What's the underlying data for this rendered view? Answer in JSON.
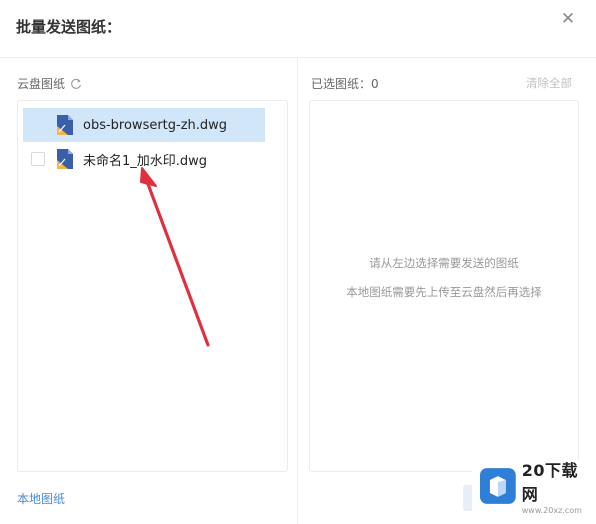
{
  "dialog": {
    "title": "批量发送图纸："
  },
  "left": {
    "header": "云盘图纸",
    "files": [
      {
        "name": "obs-browsertg-zh.dwg",
        "selected": true
      },
      {
        "name": "未命名1_加水印.dwg",
        "selected": false
      }
    ],
    "local_link": "本地图纸"
  },
  "right": {
    "selected_label": "已选图纸：",
    "selected_count": "0",
    "clear_all": "清除全部",
    "hint_1": "请从左边选择需要发送的图纸",
    "hint_2": "本地图纸需要先上传至云盘然后再选择"
  },
  "watermark": {
    "name": "20下载网",
    "url": "www.20xz.com"
  },
  "colors": {
    "accent": "#4a8bdb",
    "selected_row": "#d2e6fa",
    "arrow": "#e03040"
  },
  "icons": {
    "close": "close-icon",
    "refresh": "refresh-icon",
    "file": "dwg-file-icon"
  }
}
